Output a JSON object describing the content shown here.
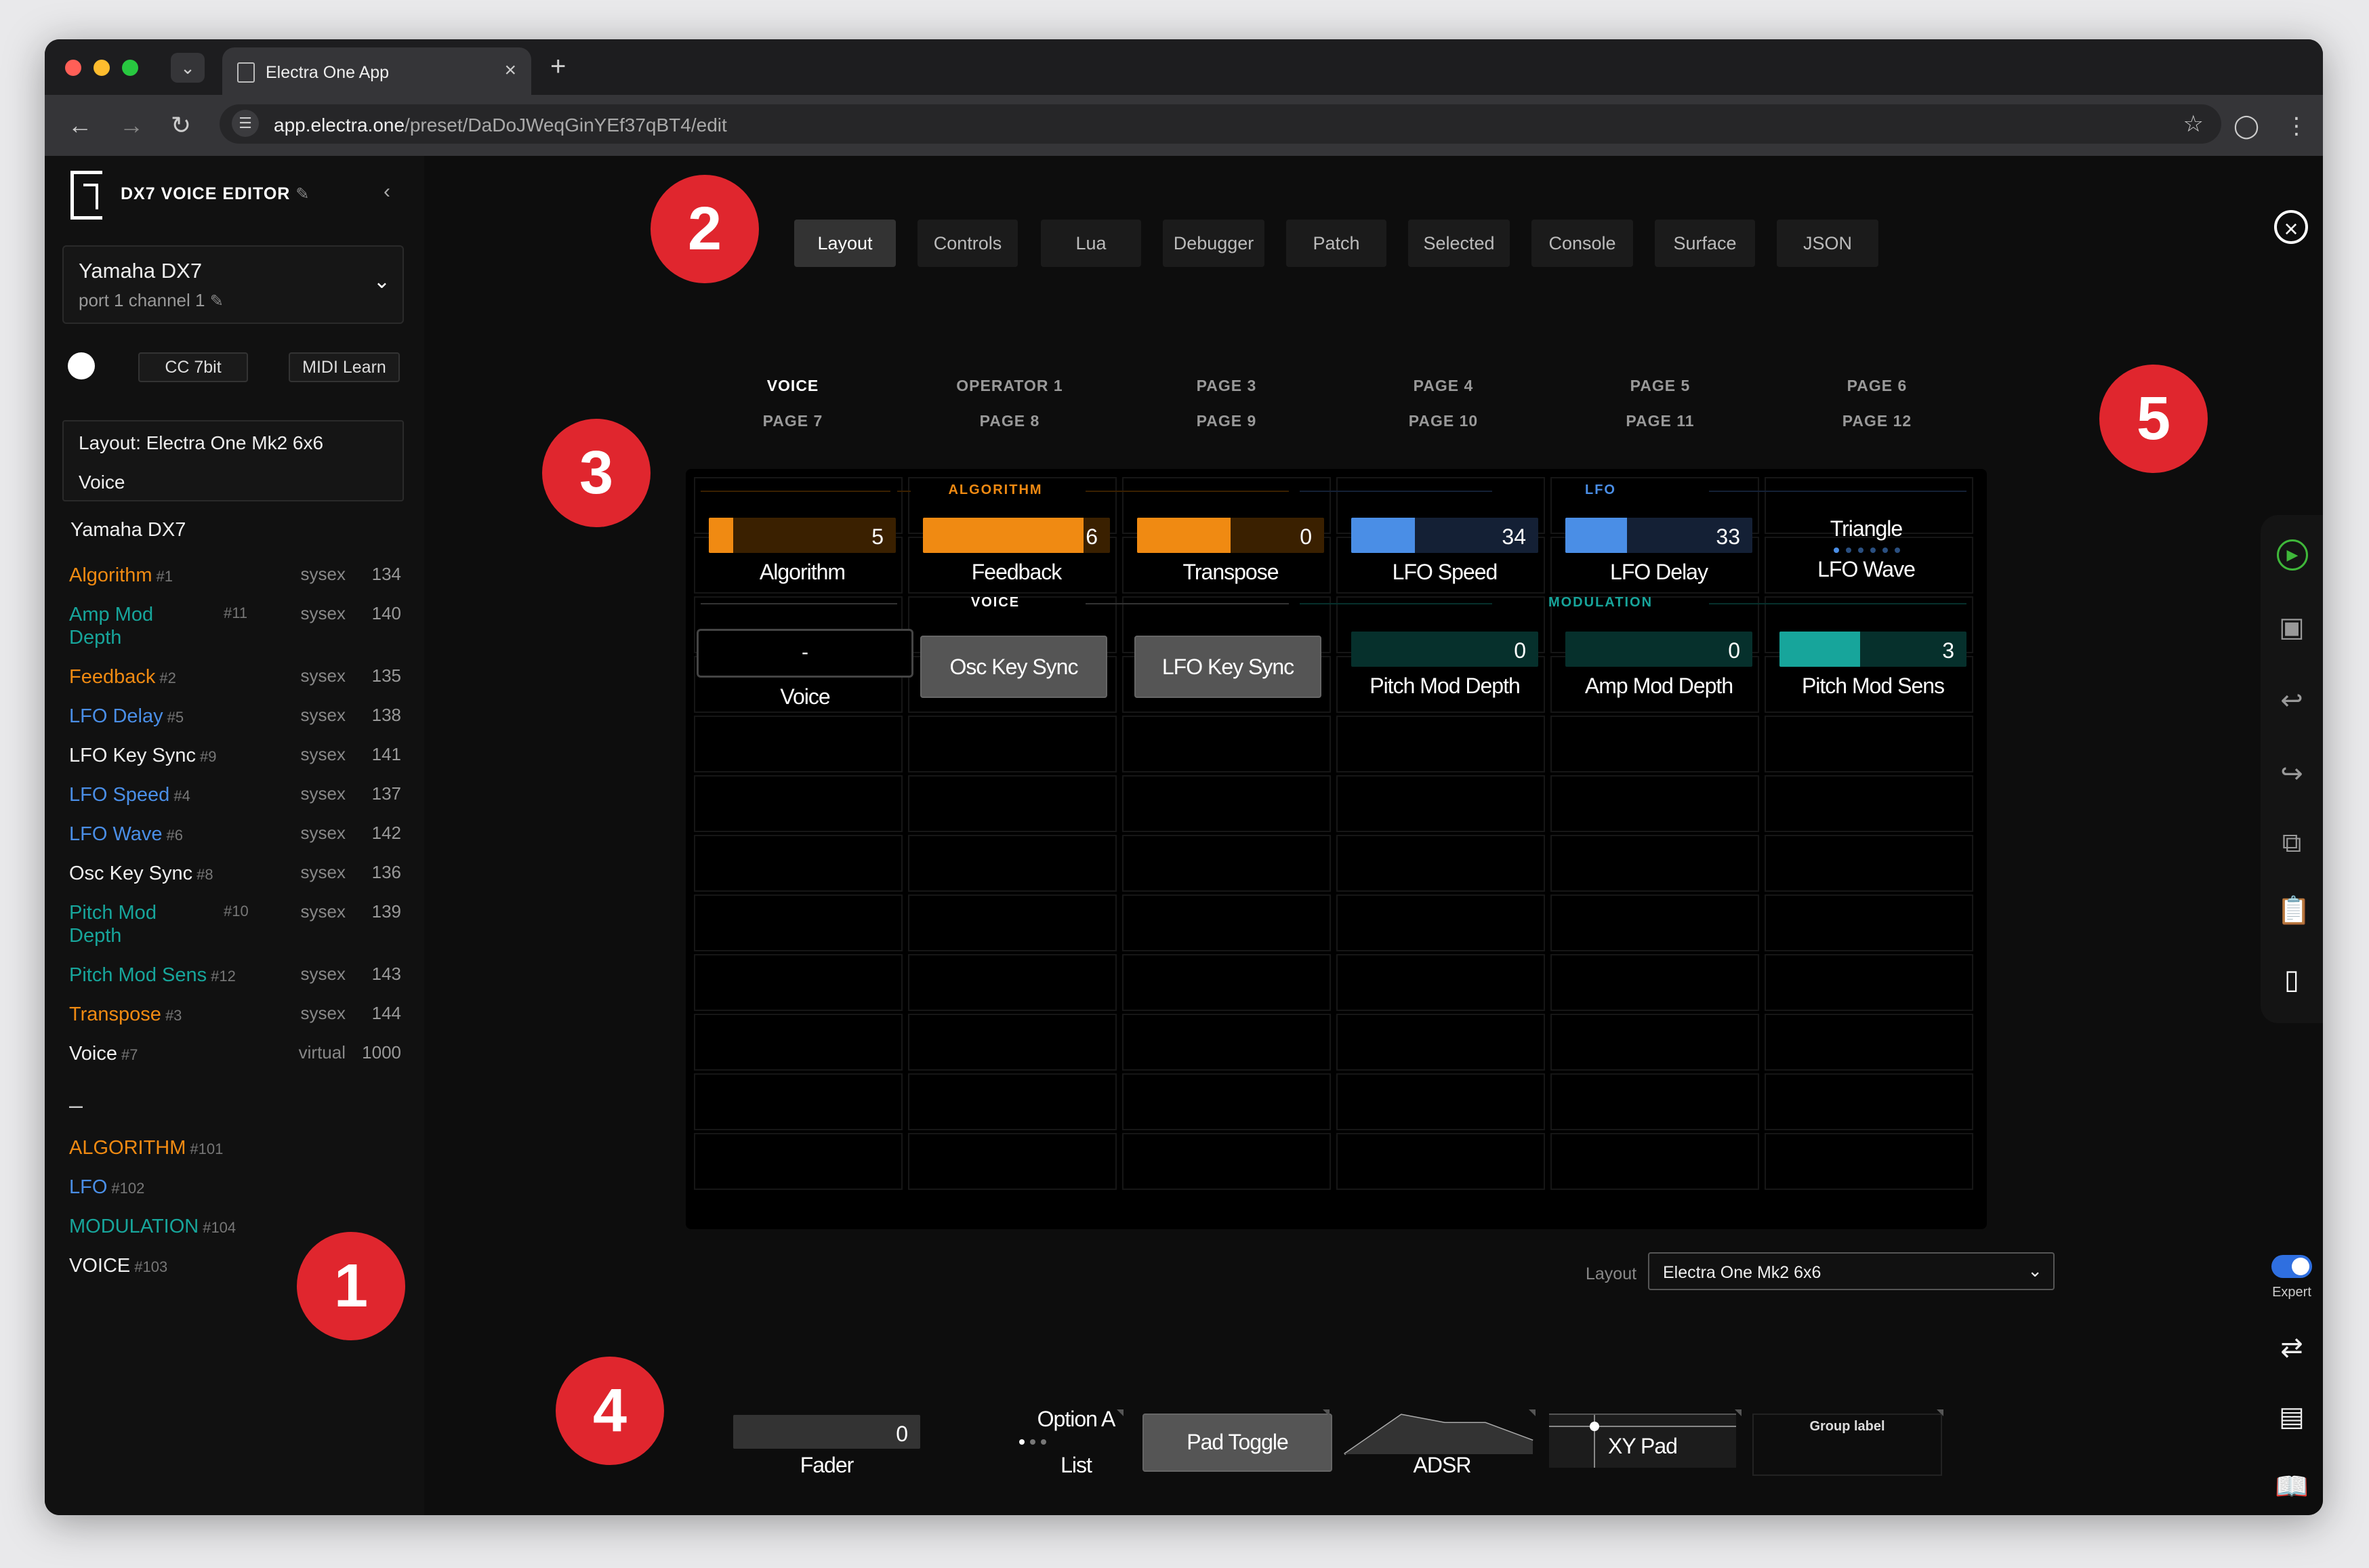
{
  "browser": {
    "tab_title": "Electra One App",
    "url_host": "app.electra.one",
    "url_path": "/preset/DaDoJWeqGinYEf37qBT4/edit"
  },
  "sidebar": {
    "app_title": "DX7 VOICE EDITOR",
    "device_name": "Yamaha DX7",
    "device_port": "port 1 channel 1",
    "cc_label": "CC 7bit",
    "midi_learn_label": "MIDI Learn",
    "layout_line": "Layout: Electra One Mk2 6x6",
    "voice_line": "Voice",
    "section_title": "Yamaha DX7",
    "controls": [
      {
        "name": "Algorithm",
        "id": "#1",
        "src": "sysex",
        "num": "134",
        "color": "#f08a12"
      },
      {
        "name": "Amp Mod\nDepth",
        "id": "#11",
        "src": "sysex",
        "num": "140",
        "color": "#17a59b"
      },
      {
        "name": "Feedback",
        "id": "#2",
        "src": "sysex",
        "num": "135",
        "color": "#f08a12"
      },
      {
        "name": "LFO Delay",
        "id": "#5",
        "src": "sysex",
        "num": "138",
        "color": "#4a8ee6"
      },
      {
        "name": "LFO Key Sync",
        "id": "#9",
        "src": "sysex",
        "num": "141",
        "color": "#eeeeee"
      },
      {
        "name": "LFO Speed",
        "id": "#4",
        "src": "sysex",
        "num": "137",
        "color": "#4a8ee6"
      },
      {
        "name": "LFO Wave",
        "id": "#6",
        "src": "sysex",
        "num": "142",
        "color": "#4a8ee6"
      },
      {
        "name": "Osc Key Sync",
        "id": "#8",
        "src": "sysex",
        "num": "136",
        "color": "#eeeeee"
      },
      {
        "name": "Pitch Mod\nDepth",
        "id": "#10",
        "src": "sysex",
        "num": "139",
        "color": "#17a59b"
      },
      {
        "name": "Pitch Mod Sens",
        "id": "#12",
        "src": "sysex",
        "num": "143",
        "color": "#17a59b"
      },
      {
        "name": "Transpose",
        "id": "#3",
        "src": "sysex",
        "num": "144",
        "color": "#f08a12"
      },
      {
        "name": "Voice",
        "id": "#7",
        "src": "virtual",
        "num": "1000",
        "color": "#eeeeee"
      }
    ],
    "separator": "–",
    "groups": [
      {
        "name": "ALGORITHM",
        "id": "#101",
        "color": "#f08a12"
      },
      {
        "name": "LFO",
        "id": "#102",
        "color": "#4a8ee6"
      },
      {
        "name": "MODULATION",
        "id": "#104",
        "color": "#17a59b"
      },
      {
        "name": "VOICE",
        "id": "#103",
        "color": "#eeeeee"
      }
    ]
  },
  "tabs": [
    "Layout",
    "Controls",
    "Lua",
    "Debugger",
    "Patch",
    "Selected",
    "Console",
    "Surface",
    "JSON"
  ],
  "active_tab": "Layout",
  "pages_row1": [
    "VOICE",
    "OPERATOR 1",
    "PAGE 3",
    "PAGE 4",
    "PAGE 5",
    "PAGE 6"
  ],
  "pages_row2": [
    "PAGE 7",
    "PAGE 8",
    "PAGE 9",
    "PAGE 10",
    "PAGE 11",
    "PAGE 12"
  ],
  "badges": [
    "1",
    "2",
    "3",
    "4",
    "5"
  ],
  "grid": {
    "groups": {
      "algorithm": "ALGORITHM",
      "lfo": "LFO",
      "voice": "VOICE",
      "modulation": "MODULATION"
    },
    "row1": [
      {
        "label": "Algorithm",
        "value": "5",
        "fill": 0.13,
        "color": "#f08a12",
        "bg": "#3a2000"
      },
      {
        "label": "Feedback",
        "value": "6",
        "fill": 0.86,
        "color": "#f08a12",
        "bg": "#3a2000"
      },
      {
        "label": "Transpose",
        "value": "0",
        "fill": 0.5,
        "color": "#f08a12",
        "bg": "#3a2000"
      },
      {
        "label": "LFO Speed",
        "value": "34",
        "fill": 0.34,
        "color": "#4a8ee6",
        "bg": "#142035"
      },
      {
        "label": "LFO Delay",
        "value": "33",
        "fill": 0.33,
        "color": "#4a8ee6",
        "bg": "#142035"
      }
    ],
    "lfo_wave": {
      "value": "Triangle",
      "label": "LFO Wave"
    },
    "voice": {
      "value": "-",
      "label": "Voice"
    },
    "osc_key_sync": "Osc Key Sync",
    "lfo_key_sync": "LFO Key Sync",
    "row2": [
      {
        "label": "Pitch Mod Depth",
        "value": "0",
        "fill": 0.0,
        "color": "#17a59b",
        "bg": "#06302c"
      },
      {
        "label": "Amp Mod Depth",
        "value": "0",
        "fill": 0.0,
        "color": "#17a59b",
        "bg": "#06302c"
      },
      {
        "label": "Pitch Mod Sens",
        "value": "3",
        "fill": 0.43,
        "color": "#17a59b",
        "bg": "#06302c"
      }
    ]
  },
  "layout_select": {
    "label": "Layout",
    "value": "Electra One Mk2 6x6"
  },
  "palette": {
    "fader_value": "0",
    "fader_label": "Fader",
    "list_value": "Option A",
    "list_label": "List",
    "pad_label": "Pad Toggle",
    "adsr_label": "ADSR",
    "xy_label": "XY Pad",
    "group_label": "Group label"
  },
  "right_rail": {
    "expert_label": "Expert"
  }
}
